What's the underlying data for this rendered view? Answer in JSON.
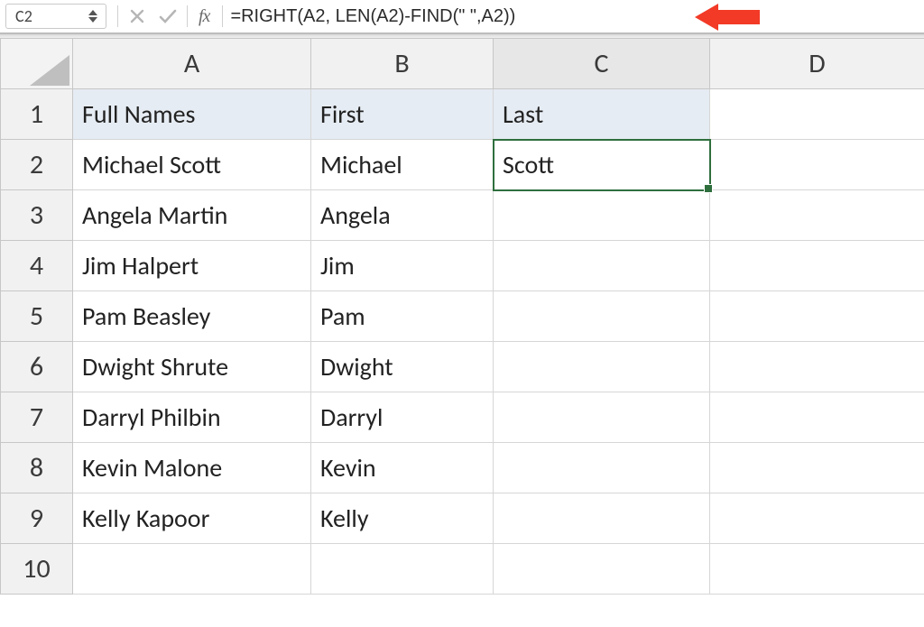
{
  "name_box": {
    "value": "C2"
  },
  "formula_bar": {
    "formula": "=RIGHT(A2, LEN(A2)-FIND(\" \",A2))",
    "fx_label": "fx"
  },
  "columns": [
    "A",
    "B",
    "C",
    "D"
  ],
  "rows": [
    "1",
    "2",
    "3",
    "4",
    "5",
    "6",
    "7",
    "8",
    "9",
    "10"
  ],
  "selected_cell": "C2",
  "data": {
    "headers": {
      "A": "Full Names",
      "B": "First",
      "C": "Last"
    },
    "body": [
      {
        "A": "Michael Scott",
        "B": "Michael",
        "C": "Scott"
      },
      {
        "A": "Angela Martin",
        "B": "Angela",
        "C": ""
      },
      {
        "A": "Jim Halpert",
        "B": "Jim",
        "C": ""
      },
      {
        "A": "Pam Beasley",
        "B": "Pam",
        "C": ""
      },
      {
        "A": "Dwight Shrute",
        "B": "Dwight",
        "C": ""
      },
      {
        "A": "Darryl Philbin",
        "B": "Darryl",
        "C": ""
      },
      {
        "A": "Kevin Malone",
        "B": "Kevin",
        "C": ""
      },
      {
        "A": "Kelly Kapoor",
        "B": "Kelly",
        "C": ""
      },
      {
        "A": "",
        "B": "",
        "C": ""
      }
    ]
  },
  "annotation": {
    "arrow_color": "#f23a26"
  }
}
